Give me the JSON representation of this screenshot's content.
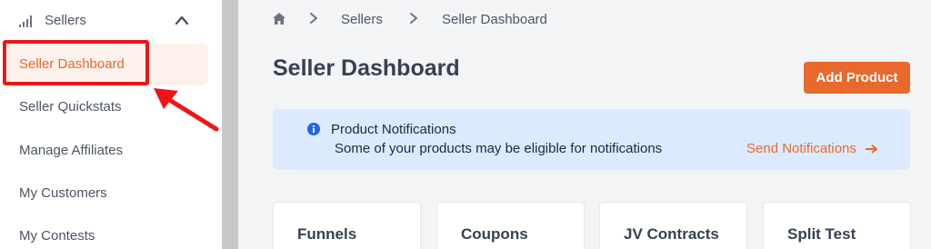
{
  "sidebar": {
    "section_title": "Sellers",
    "section_icon": "signal-bars-icon",
    "items": [
      {
        "label": "Seller Dashboard",
        "active": true
      },
      {
        "label": "Seller Quickstats"
      },
      {
        "label": "Manage Affiliates"
      },
      {
        "label": "My Customers"
      },
      {
        "label": "My Contests"
      }
    ]
  },
  "breadcrumb": {
    "home_icon": "home-icon",
    "items": [
      "Sellers",
      "Seller Dashboard"
    ]
  },
  "main": {
    "title": "Seller Dashboard",
    "add_button": "Add Product",
    "notification": {
      "title": "Product Notifications",
      "text": "Some of your products may be eligible for notifications",
      "link": "Send Notifications"
    },
    "cards": [
      "Funnels",
      "Coupons",
      "JV Contracts",
      "Split Test"
    ]
  },
  "colors": {
    "accent": "#e8692c",
    "annotation": "#ef1515",
    "notice_bg": "#dbeafe",
    "active_bg": "#fdf1ec"
  }
}
